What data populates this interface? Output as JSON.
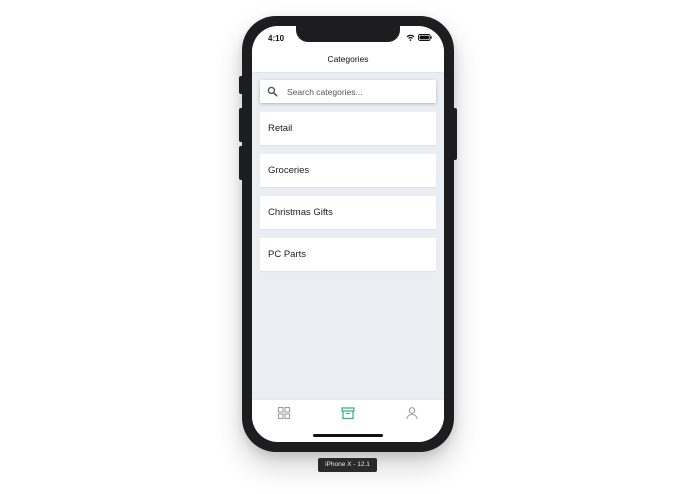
{
  "status_bar": {
    "time": "4:10"
  },
  "nav": {
    "title": "Categories"
  },
  "search": {
    "placeholder": "Search categories...",
    "value": ""
  },
  "categories": [
    {
      "label": "Retail"
    },
    {
      "label": "Groceries"
    },
    {
      "label": "Christmas Gifts"
    },
    {
      "label": "PC Parts"
    }
  ],
  "tab_bar": {
    "tabs": [
      {
        "icon": "grid-icon",
        "active": false
      },
      {
        "icon": "archive-box-icon",
        "active": true
      },
      {
        "icon": "user-icon",
        "active": false
      }
    ],
    "active_color": "#2bb36f",
    "inactive_color": "#9aa0a8"
  },
  "device": {
    "label": "iPhone X - 12.1"
  }
}
